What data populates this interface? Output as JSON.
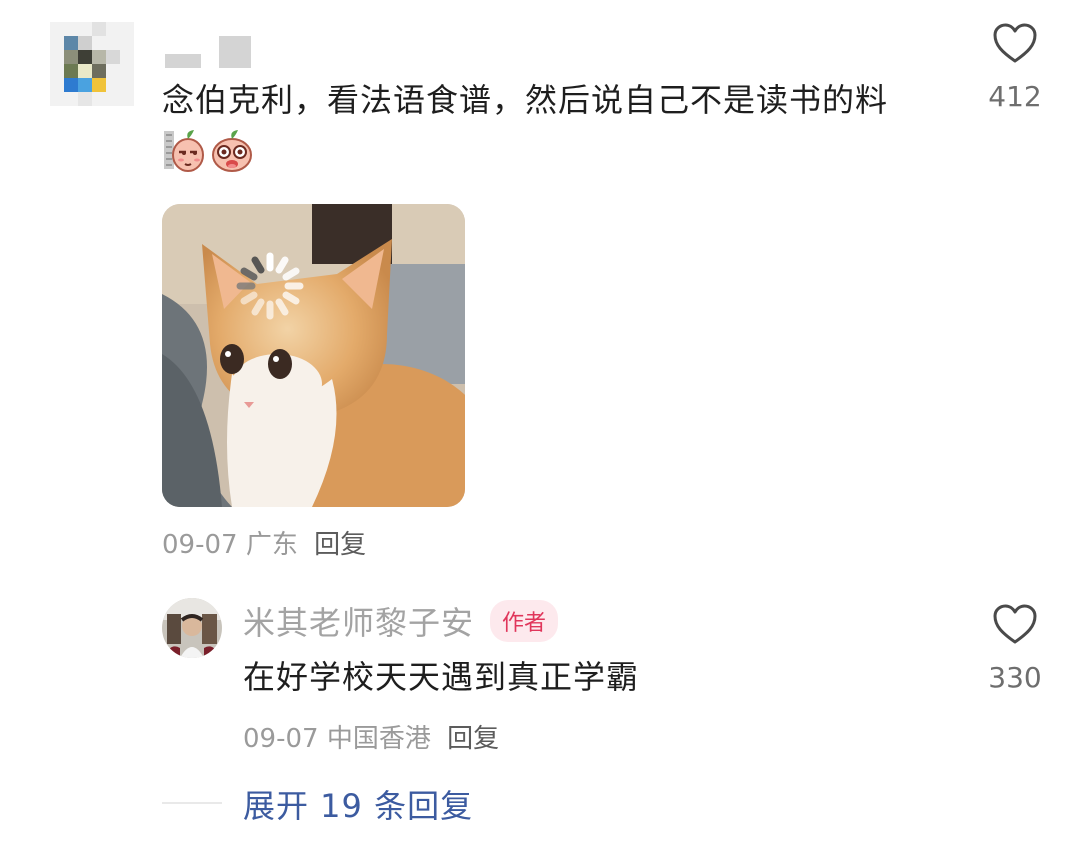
{
  "comment": {
    "text": "念伯克利，看法语食谱，然后说自己不是读书的料",
    "emojis": [
      "side-eye-peach-emoji",
      "drooling-peach-emoji"
    ],
    "image": "orange-kitten-loading-meme",
    "date": "09-07",
    "location": "广东",
    "reply_label": "回复",
    "likes": "412"
  },
  "reply": {
    "author": "米其老师黎子安",
    "badge": "作者",
    "text": "在好学校天天遇到真正学霸",
    "date": "09-07",
    "location": "中国香港",
    "reply_label": "回复",
    "likes": "330"
  },
  "expand_label": "展开 19 条回复",
  "colors": {
    "accent_link": "#3c5ba0",
    "badge_red": "#e0365b",
    "meta_gray": "#9a9a9a"
  }
}
